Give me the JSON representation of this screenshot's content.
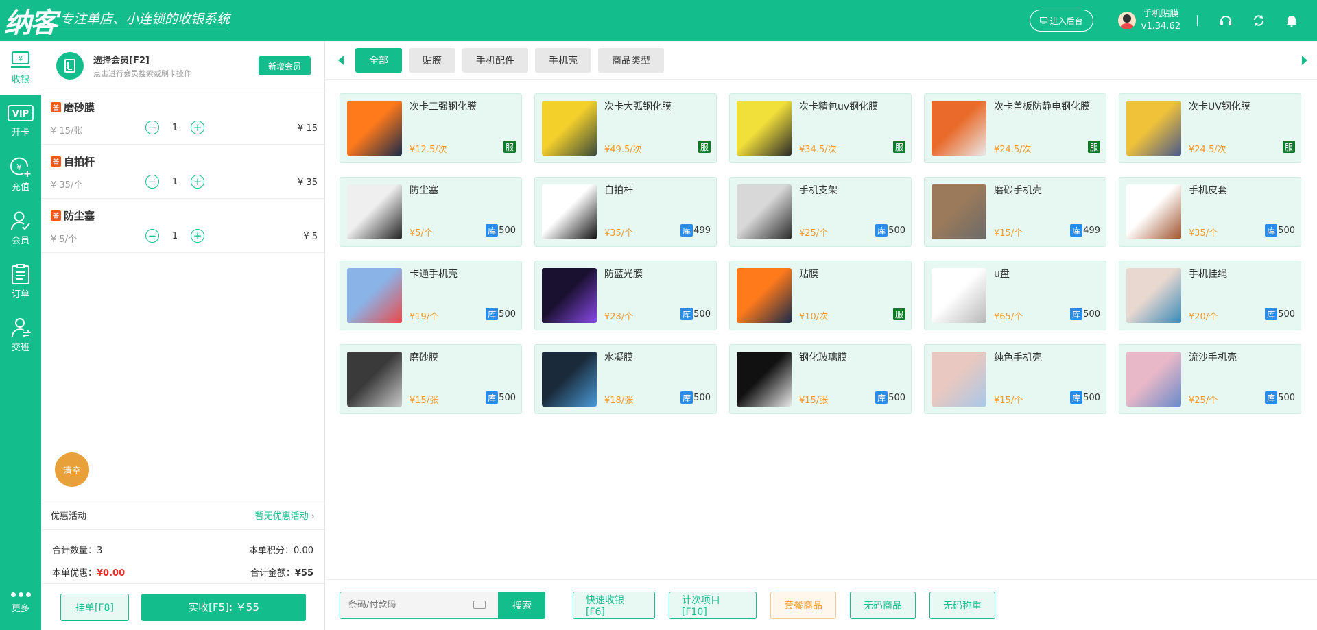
{
  "header": {
    "logo": "纳客",
    "slogan": "专注单店、小连锁的收银系统",
    "backend_button": "进入后台",
    "user_name": "手机贴膜",
    "version": "v1.34.62"
  },
  "sidebar": {
    "items": [
      {
        "label": "收银",
        "icon": "cashier-icon"
      },
      {
        "label": "开卡",
        "icon": "vip-card-icon"
      },
      {
        "label": "充值",
        "icon": "recharge-icon"
      },
      {
        "label": "会员",
        "icon": "member-icon"
      },
      {
        "label": "订单",
        "icon": "order-icon"
      },
      {
        "label": "交班",
        "icon": "shift-icon"
      }
    ],
    "more": "更多"
  },
  "member": {
    "title": "选择会员[F2]",
    "subtitle": "点击进行会员搜索或刷卡操作",
    "new_button": "新增会员"
  },
  "cart": {
    "tag": "普",
    "items": [
      {
        "name": "磨砂膜",
        "unit_price": "¥ 15/张",
        "qty": "1",
        "total": "¥ 15"
      },
      {
        "name": "自拍杆",
        "unit_price": "¥ 35/个",
        "qty": "1",
        "total": "¥ 35"
      },
      {
        "name": "防尘塞",
        "unit_price": "¥ 5/个",
        "qty": "1",
        "total": "¥ 5"
      }
    ],
    "clear": "清空",
    "promo_label": "优惠活动",
    "promo_value": "暂无优惠活动",
    "qty_label": "合计数量：",
    "qty_value": "3",
    "points_label": "本单积分：",
    "points_value": "0.00",
    "discount_label": "本单优惠：",
    "discount_value": "¥0.00",
    "total_label": "合计金额：",
    "total_value": "¥55",
    "hang_button": "挂单[F8]",
    "pay_button": "实收[F5]: ￥55"
  },
  "tabs": [
    "全部",
    "贴膜",
    "手机配件",
    "手机壳",
    "商品类型"
  ],
  "stock_tag": "库",
  "service_tag": "服",
  "products": [
    {
      "name": "次卡三强钢化膜",
      "price": "¥12.5/次",
      "stock": "",
      "thumb": [
        "#ff7a1a",
        "#1a2a4a"
      ]
    },
    {
      "name": "次卡大弧钢化膜",
      "price": "¥49.5/次",
      "stock": "",
      "thumb": [
        "#f4d02a",
        "#3a4a3a"
      ]
    },
    {
      "name": "次卡精包uv钢化膜",
      "price": "¥34.5/次",
      "stock": "",
      "thumb": [
        "#f2e03a",
        "#2a2a2a"
      ]
    },
    {
      "name": "次卡盖板防静电钢化膜",
      "price": "¥24.5/次",
      "stock": "",
      "thumb": [
        "#e96a2a",
        "#e9e9e9"
      ]
    },
    {
      "name": "次卡UV钢化膜",
      "price": "¥24.5/次",
      "stock": "",
      "thumb": [
        "#f0c23a",
        "#4a5a8a"
      ]
    },
    {
      "name": "防尘塞",
      "price": "¥5/个",
      "stock": "500",
      "thumb": [
        "#efefef",
        "#222222"
      ]
    },
    {
      "name": "自拍杆",
      "price": "¥35/个",
      "stock": "499",
      "thumb": [
        "#ffffff",
        "#111111"
      ]
    },
    {
      "name": "手机支架",
      "price": "¥25/个",
      "stock": "500",
      "thumb": [
        "#d8d8d8",
        "#2a2a2a"
      ]
    },
    {
      "name": "磨砂手机壳",
      "price": "¥15/个",
      "stock": "499",
      "thumb": [
        "#9a7a5a",
        "#6a6a6a"
      ]
    },
    {
      "name": "手机皮套",
      "price": "¥35/个",
      "stock": "500",
      "thumb": [
        "#ffffff",
        "#a0522d"
      ]
    },
    {
      "name": "卡通手机壳",
      "price": "¥19/个",
      "stock": "500",
      "thumb": [
        "#8ab4e8",
        "#e84a4a"
      ]
    },
    {
      "name": "防蓝光膜",
      "price": "¥28/个",
      "stock": "500",
      "thumb": [
        "#1a1030",
        "#8a4ae8"
      ]
    },
    {
      "name": "贴膜",
      "price": "¥10/次",
      "stock": "",
      "thumb": [
        "#ff7a1a",
        "#1a2a4a"
      ]
    },
    {
      "name": "u盘",
      "price": "¥65/个",
      "stock": "500",
      "thumb": [
        "#ffffff",
        "#b8b8b8"
      ]
    },
    {
      "name": "手机挂绳",
      "price": "¥20/个",
      "stock": "500",
      "thumb": [
        "#e8d8d0",
        "#3a8ab8"
      ]
    },
    {
      "name": "磨砂膜",
      "price": "¥15/张",
      "stock": "500",
      "thumb": [
        "#3a3a3a",
        "#c8c8c8"
      ]
    },
    {
      "name": "水凝膜",
      "price": "¥18/张",
      "stock": "500",
      "thumb": [
        "#1a2a3a",
        "#4a9ad8"
      ]
    },
    {
      "name": "钢化玻璃膜",
      "price": "¥15/张",
      "stock": "500",
      "thumb": [
        "#111111",
        "#e8e8e8"
      ]
    },
    {
      "name": "纯色手机壳",
      "price": "¥15/个",
      "stock": "500",
      "thumb": [
        "#e8c8c0",
        "#a8c8e8"
      ]
    },
    {
      "name": "流沙手机壳",
      "price": "¥25/个",
      "stock": "500",
      "thumb": [
        "#e8b8c8",
        "#6a8ac8"
      ]
    }
  ],
  "bottom": {
    "search_placeholder": "条码/付款码",
    "search_button": "搜索",
    "quick_button": "快速收银[F6]",
    "count_button": "计次项目[F10]",
    "package_button": "套餐商品",
    "nocode_button": "无码商品",
    "weigh_button": "无码称重"
  },
  "colors": {
    "brand": "#13bd8c",
    "price": "#f39a2e",
    "discount": "#e8312a",
    "stock_badge": "#2b8be6",
    "service_badge": "#0f7a28"
  }
}
